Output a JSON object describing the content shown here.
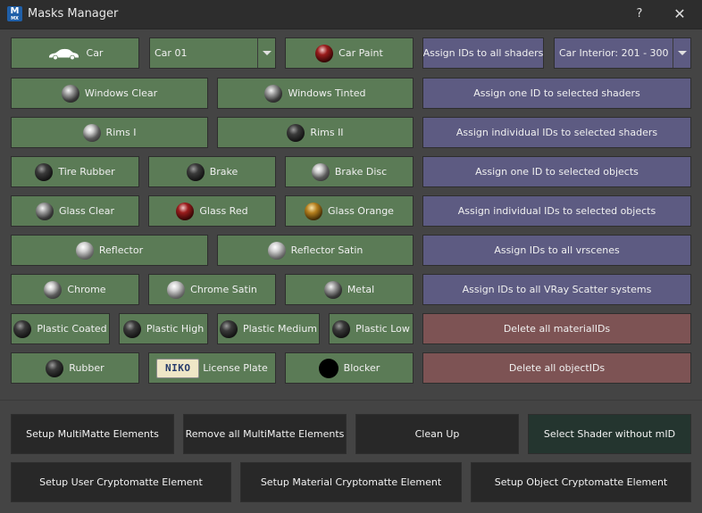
{
  "window": {
    "title": "Masks Manager",
    "help": "?",
    "close": "✕",
    "app_icon_letter": "M",
    "app_icon_sub": "MX"
  },
  "materials": {
    "car": "Car",
    "car_select_value": "Car 01",
    "car_paint": "Car Paint",
    "windows_clear": "Windows Clear",
    "windows_tinted": "Windows Tinted",
    "rims_1": "Rims I",
    "rims_2": "Rims II",
    "tire_rubber": "Tire Rubber",
    "brake": "Brake",
    "brake_disc": "Brake Disc",
    "glass_clear": "Glass Clear",
    "glass_red": "Glass Red",
    "glass_orange": "Glass Orange",
    "reflector": "Reflector",
    "reflector_satin": "Reflector Satin",
    "chrome": "Chrome",
    "chrome_satin": "Chrome Satin",
    "metal": "Metal",
    "plastic_coated": "Plastic Coated",
    "plastic_high": "Plastic High",
    "plastic_medium": "Plastic Medium",
    "plastic_low": "Plastic Low",
    "rubber": "Rubber",
    "license_plate": "License Plate",
    "license_plate_text": "NIKO",
    "blocker": "Blocker"
  },
  "assign": {
    "all_shaders": "Assign IDs to all shaders",
    "range_select_value": "Car Interior: 201 - 300",
    "one_id_shaders": "Assign one ID to selected shaders",
    "individual_ids_shaders": "Assign individual IDs to selected shaders",
    "one_id_objects": "Assign one ID to selected objects",
    "individual_ids_objects": "Assign individual IDs to selected objects",
    "all_vrscenes": "Assign IDs to all vrscenes",
    "all_scatter": "Assign IDs to all VRay Scatter systems",
    "delete_material_ids": "Delete all materialIDs",
    "delete_object_ids": "Delete all objectIDs"
  },
  "bottom": {
    "setup_multimatte": "Setup MultiMatte Elements",
    "remove_multimatte": "Remove all MultiMatte Elements",
    "clean_up": "Clean Up",
    "select_shader_without_mid": "Select Shader without mID",
    "setup_user_crypto": "Setup User Cryptomatte Element",
    "setup_material_crypto": "Setup Material Cryptomatte Element",
    "setup_object_crypto": "Setup Object Cryptomatte Element"
  },
  "colors": {
    "material_button": "#5b7b56",
    "assign_button": "#5d5b82",
    "delete_button": "#7d5354",
    "bottom_button": "#282828",
    "bottom_highlight_button": "#24352f",
    "background": "#444444"
  }
}
